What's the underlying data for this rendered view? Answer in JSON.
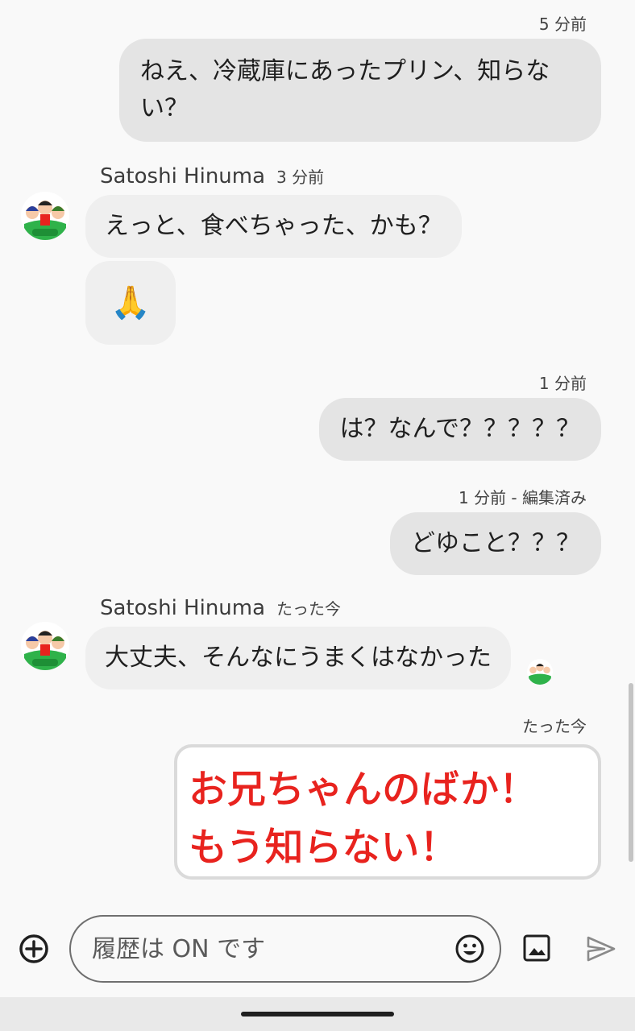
{
  "conversation": {
    "msg1": {
      "time": "5 分前",
      "text": "ねえ、冷蔵庫にあったプリン、知らない？"
    },
    "group1": {
      "sender": "Satoshi Hinuma",
      "time": "3 分前",
      "text": "えっと、食べちゃった、かも？",
      "emoji": "🙏"
    },
    "msg2": {
      "time": "1 分前",
      "text": "は？なんで？？？？？"
    },
    "msg3": {
      "time": "1 分前 - 編集済み",
      "text": "どゆこと？？？"
    },
    "group2": {
      "sender": "Satoshi Hinuma",
      "time": "たった今",
      "text": "大丈夫、そんなにうまくはなかった"
    },
    "msg4": {
      "time": "たった今",
      "drawing_line1": "お兄ちゃんのばか！",
      "drawing_line2": "もう知らない！",
      "ink_color": "#e8231e"
    }
  },
  "composer": {
    "placeholder": "履歴は ON です",
    "value": ""
  },
  "icons": {
    "add": "add-circle-icon",
    "emoji": "emoji-icon",
    "image": "image-icon",
    "send": "send-icon"
  },
  "colors": {
    "outgoing_bubble": "#e4e4e4",
    "incoming_bubble": "#efefef",
    "avatar_green": "#2fb24a"
  }
}
